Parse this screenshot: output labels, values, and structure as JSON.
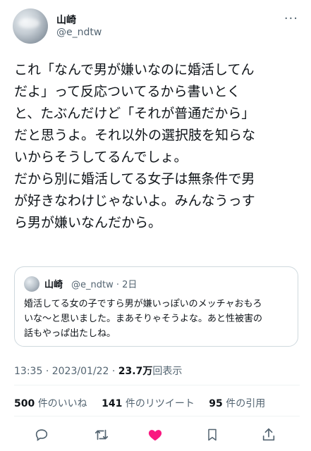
{
  "author": {
    "name": "山崎",
    "handle": "@e_ndtw"
  },
  "tweet": {
    "text": "これ「なんで男が嫌いなのに婚活してん\nだよ」って反応ついてるから書いとく\nと、たぶんだけど「それが普通だから」\nだと思うよ。それ以外の選択肢を知らな\nいからそうしてるんでしょ。\nだから別に婚活してる女子は無条件で男\nが好きなわけじゃないよ。みんなうっす\nら男が嫌いなんだから。"
  },
  "quote": {
    "name": "山崎",
    "handle_time": "@e_ndtw · 2日",
    "text": "婚活してる女の子ですら男が嫌いっぽいのメッチャおもろ\nいな〜と思いました。まあそりゃそうよな。あと性被害の\n話もやっぱ出たしね。"
  },
  "meta": {
    "time": "13:35",
    "sep": "·",
    "date": "2023/01/22",
    "sep2": "·",
    "views": "23.7万",
    "views_label": "回表示"
  },
  "stats": {
    "likes_count": "500",
    "likes_label": "件のいいね",
    "retweets_count": "141",
    "retweets_label": "件のリツイート",
    "quotes_count": "95",
    "quotes_label": "件の引用"
  },
  "icons": {
    "more": "more-icon",
    "reply": "reply-icon",
    "retweet": "retweet-icon",
    "like": "like-icon",
    "bookmark": "bookmark-icon",
    "share": "share-icon"
  },
  "colors": {
    "like": "#f91880",
    "secondary": "#536471",
    "text": "#0f1419"
  }
}
